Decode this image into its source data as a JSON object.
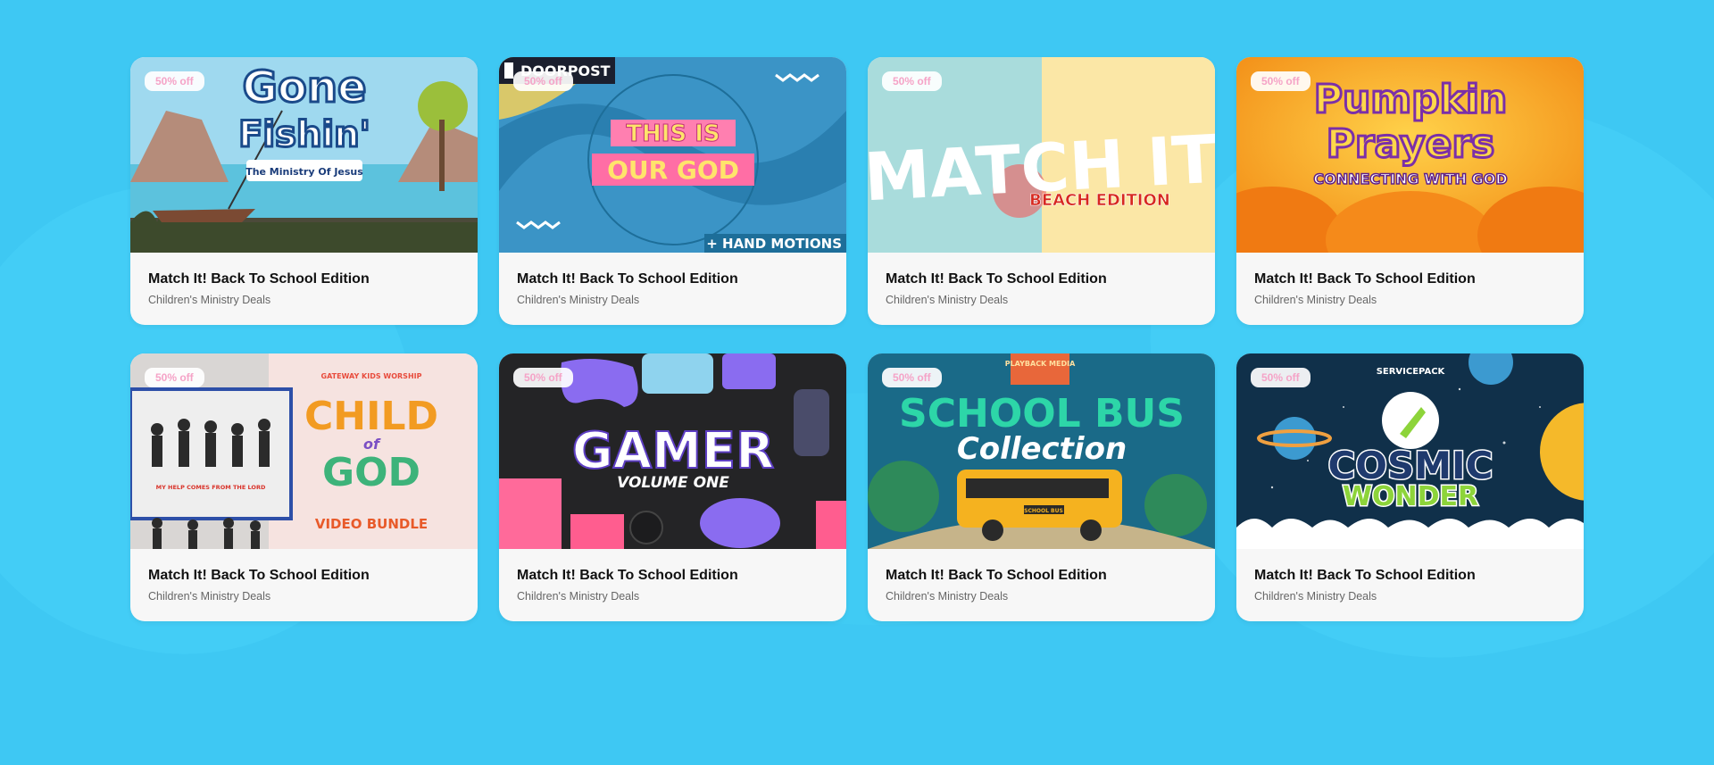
{
  "colors": {
    "page_background": "#3ec8f3",
    "card_background": "#f7f7f7",
    "badge_text": "#f5a3c7"
  },
  "cards": [
    {
      "badge": "50% off",
      "title": "Match It! Back To School Edition",
      "subtitle": "Children's Ministry Deals",
      "art": {
        "line1": "Gone",
        "line2": "Fishin'",
        "banner": "The Ministry Of Jesus"
      }
    },
    {
      "badge": "50% off",
      "title": "Match It! Back To School Edition",
      "subtitle": "Children's Ministry Deals",
      "art": {
        "brand": "DOORPOST",
        "line1": "THIS IS",
        "line2": "OUR GOD",
        "footer": "+ HAND MOTIONS"
      }
    },
    {
      "badge": "50% off",
      "title": "Match It! Back To School Edition",
      "subtitle": "Children's Ministry Deals",
      "art": {
        "line1": "MATCH IT",
        "line2": "BEACH EDITION"
      }
    },
    {
      "badge": "50% off",
      "title": "Match It! Back To School Edition",
      "subtitle": "Children's Ministry Deals",
      "art": {
        "line1": "Pumpkin",
        "line2": "Prayers",
        "line3": "CONNECTING WITH GOD"
      }
    },
    {
      "badge": "50% off",
      "title": "Match It! Back To School Edition",
      "subtitle": "Children's Ministry Deals",
      "art": {
        "brand": "GATEWAY KIDS WORSHIP",
        "line1": "CHILD",
        "line2": "of",
        "line3": "GOD",
        "footer": "VIDEO BUNDLE",
        "caption": "MY HELP COMES FROM THE LORD"
      }
    },
    {
      "badge": "50% off",
      "title": "Match It! Back To School Edition",
      "subtitle": "Children's Ministry Deals",
      "art": {
        "line1": "GAMER",
        "line2": "VOLUME ONE"
      }
    },
    {
      "badge": "50% off",
      "title": "Match It! Back To School Edition",
      "subtitle": "Children's Ministry Deals",
      "art": {
        "brand": "PLAYBACK MEDIA",
        "line1": "SCHOOL BUS",
        "line2": "Collection",
        "bus_label": "SCHOOL BUS"
      }
    },
    {
      "badge": "50% off",
      "title": "Match It! Back To School Edition",
      "subtitle": "Children's Ministry Deals",
      "art": {
        "brand": "SERVICEPACK",
        "line1": "COSMIC",
        "line2": "WONDER"
      }
    }
  ]
}
